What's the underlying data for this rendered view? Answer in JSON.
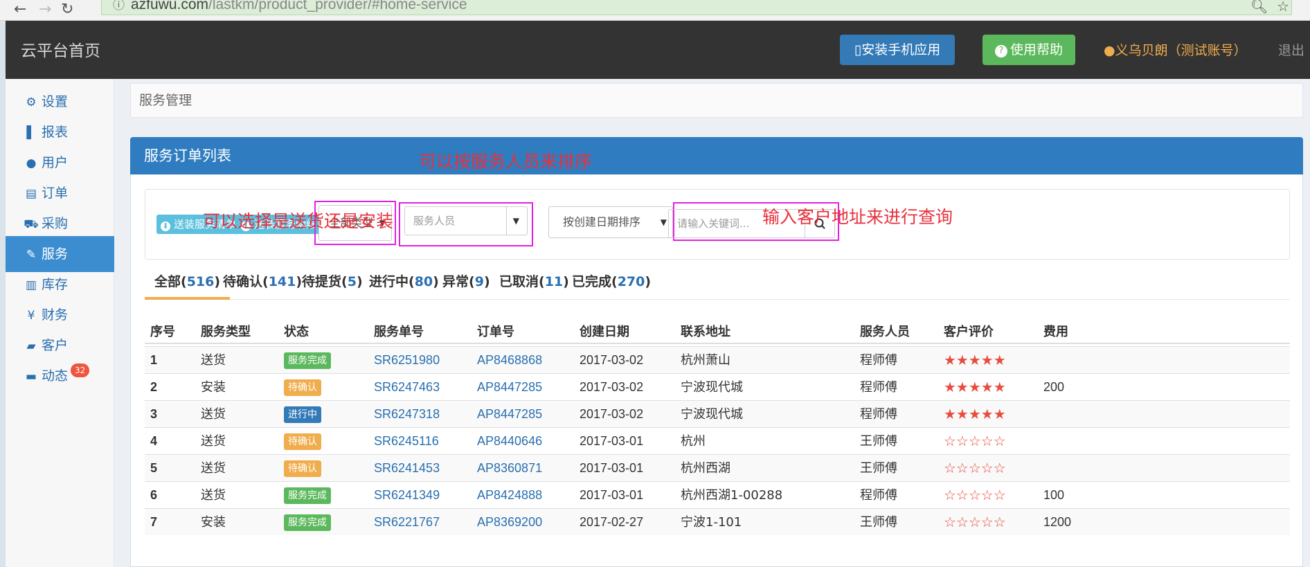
{
  "browser": {
    "url_host": "azfuwu.com",
    "url_path": "/lastkm/product_provider/#home-service"
  },
  "header": {
    "brand": "云平台首页",
    "install_label": "安装手机应用",
    "help_label": "使用帮助",
    "user_label": "义乌贝朗（测试账号）",
    "logout_label": "退出"
  },
  "sidebar": {
    "items": [
      {
        "label": "设置",
        "icon": "gear-icon",
        "glyph": "⚙"
      },
      {
        "label": "报表",
        "icon": "bar-chart-icon",
        "glyph": "▌"
      },
      {
        "label": "用户",
        "icon": "user-icon",
        "glyph": "●"
      },
      {
        "label": "订单",
        "icon": "list-icon",
        "glyph": "▤"
      },
      {
        "label": "采购",
        "icon": "cart-icon",
        "glyph": "⛟"
      },
      {
        "label": "服务",
        "icon": "wrench-icon",
        "glyph": "✎"
      },
      {
        "label": "库存",
        "icon": "barcode-icon",
        "glyph": "▥"
      },
      {
        "label": "财务",
        "icon": "yen-icon",
        "glyph": "¥"
      },
      {
        "label": "客户",
        "icon": "briefcase-icon",
        "glyph": "▰"
      },
      {
        "label": "动态",
        "icon": "comment-icon",
        "glyph": "▬",
        "badge": "32"
      }
    ],
    "active_index": 5
  },
  "breadcrumb": "服务管理",
  "panel": {
    "title": "服务订单列表"
  },
  "filters": {
    "chip_delivery": "送装服务清单",
    "chip_detail": "送装服务明细",
    "type_select": "全部类型",
    "staff_placeholder": "服务人员",
    "sort_select": "按创建日期排序",
    "search_placeholder": "请输入关键词..."
  },
  "annotations": {
    "staff_note": "可以按服务人员来排序",
    "type_note": "可以选择是送货还是安装",
    "search_note": "输入客户地址来进行查询"
  },
  "tabs": [
    {
      "label": "全部",
      "count": "516"
    },
    {
      "label": "待确认",
      "count": "141"
    },
    {
      "label": "待提货",
      "count": "5"
    },
    {
      "label": "进行中",
      "count": "80"
    },
    {
      "label": "异常",
      "count": "9"
    },
    {
      "label": "已取消",
      "count": "11"
    },
    {
      "label": "已完成",
      "count": "270"
    }
  ],
  "table": {
    "headers": [
      "序号",
      "服务类型",
      "状态",
      "服务单号",
      "订单号",
      "创建日期",
      "联系地址",
      "服务人员",
      "客户评价",
      "费用"
    ],
    "rows": [
      {
        "idx": "1",
        "type": "送货",
        "status": "服务完成",
        "status_color": "#5cb85c",
        "service_no": "SR6251980",
        "order_no": "AP8468868",
        "date": "2017-03-02",
        "addr": "杭州萧山",
        "staff": "程师傅",
        "rating": 5,
        "fee": ""
      },
      {
        "idx": "2",
        "type": "安装",
        "status": "待确认",
        "status_color": "#f0ad4e",
        "service_no": "SR6247463",
        "order_no": "AP8447285",
        "date": "2017-03-02",
        "addr": "宁波现代城",
        "staff": "程师傅",
        "rating": 5,
        "fee": "200"
      },
      {
        "idx": "3",
        "type": "送货",
        "status": "进行中",
        "status_color": "#337ab7",
        "service_no": "SR6247318",
        "order_no": "AP8447285",
        "date": "2017-03-02",
        "addr": "宁波现代城",
        "staff": "程师傅",
        "rating": 5,
        "fee": ""
      },
      {
        "idx": "4",
        "type": "送货",
        "status": "待确认",
        "status_color": "#f0ad4e",
        "service_no": "SR6245116",
        "order_no": "AP8440646",
        "date": "2017-03-01",
        "addr": "杭州",
        "staff": "王师傅",
        "rating": 0,
        "fee": ""
      },
      {
        "idx": "5",
        "type": "送货",
        "status": "待确认",
        "status_color": "#f0ad4e",
        "service_no": "SR6241453",
        "order_no": "AP8360871",
        "date": "2017-03-01",
        "addr": "杭州西湖",
        "staff": "王师傅",
        "rating": 0,
        "fee": ""
      },
      {
        "idx": "6",
        "type": "送货",
        "status": "服务完成",
        "status_color": "#5cb85c",
        "service_no": "SR6241349",
        "order_no": "AP8424888",
        "date": "2017-03-01",
        "addr": "杭州西湖1-00288",
        "staff": "程师傅",
        "rating": 0,
        "fee": "100"
      },
      {
        "idx": "7",
        "type": "安装",
        "status": "服务完成",
        "status_color": "#5cb85c",
        "service_no": "SR6221767",
        "order_no": "AP8369200",
        "date": "2017-02-27",
        "addr": "宁波1-101",
        "staff": "王师傅",
        "rating": 0,
        "fee": "1200"
      }
    ]
  }
}
